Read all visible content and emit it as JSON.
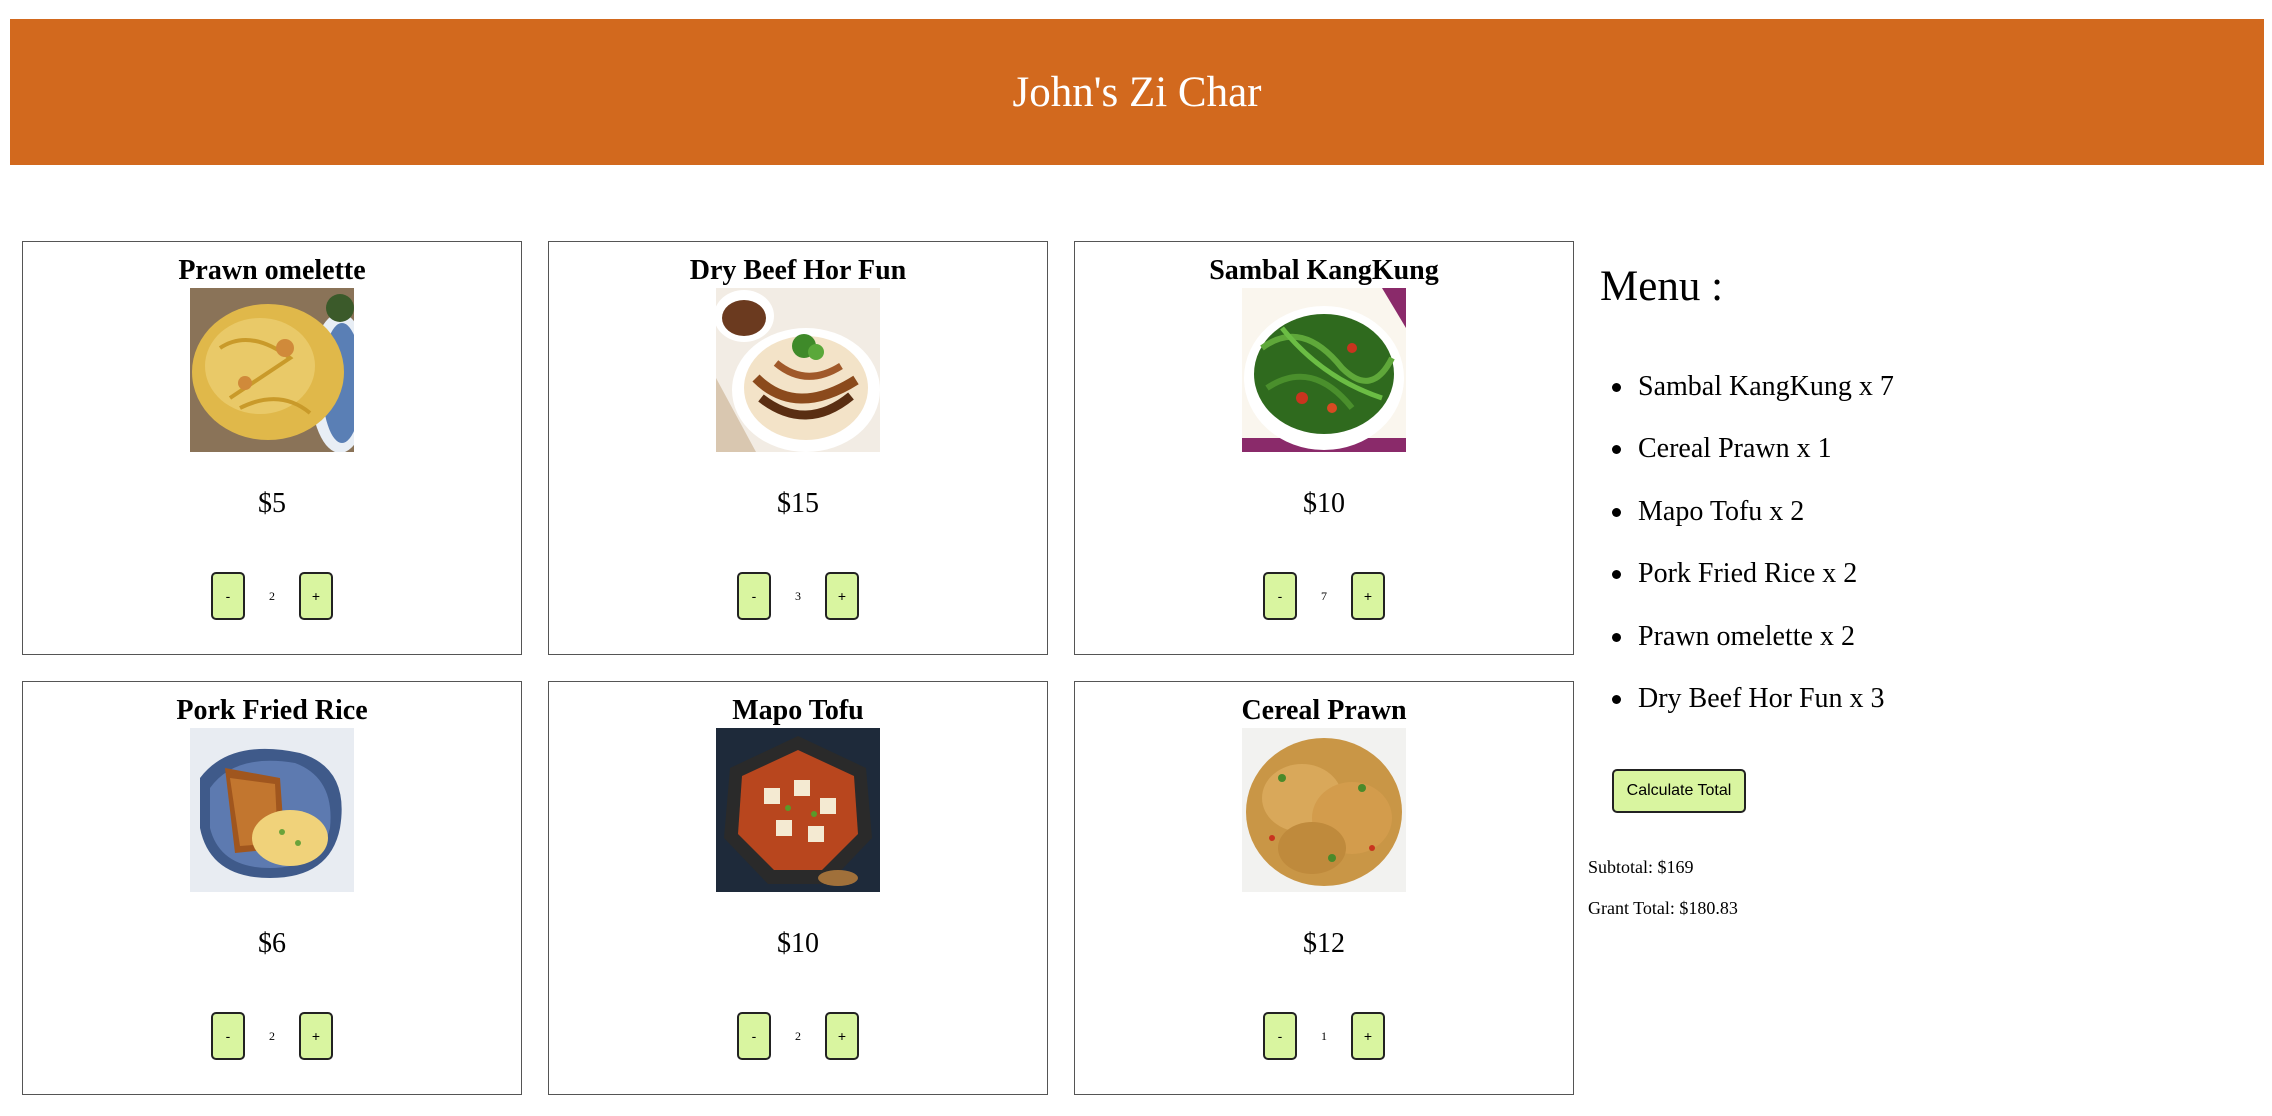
{
  "header": {
    "title": "John's Zi Char"
  },
  "dishes": [
    {
      "name": "Prawn omelette",
      "price": "$5",
      "qty": "2",
      "minus": "-",
      "plus": "+"
    },
    {
      "name": "Dry Beef Hor Fun",
      "price": "$15",
      "qty": "3",
      "minus": "-",
      "plus": "+"
    },
    {
      "name": "Sambal KangKung",
      "price": "$10",
      "qty": "7",
      "minus": "-",
      "plus": "+"
    },
    {
      "name": "Pork Fried Rice",
      "price": "$6",
      "qty": "2",
      "minus": "-",
      "plus": "+"
    },
    {
      "name": "Mapo Tofu",
      "price": "$10",
      "qty": "2",
      "minus": "-",
      "plus": "+"
    },
    {
      "name": "Cereal Prawn",
      "price": "$12",
      "qty": "1",
      "minus": "-",
      "plus": "+"
    }
  ],
  "sidebar": {
    "title": "Menu :",
    "items": [
      "Sambal KangKung x 7",
      "Cereal Prawn x 1",
      "Mapo Tofu x 2",
      "Pork Fried Rice x 2",
      "Prawn omelette x 2",
      "Dry Beef Hor Fun x 3"
    ],
    "calculate_label": "Calculate Total",
    "subtotal": "Subtotal: $169",
    "grand_total": "Grant Total: $180.83"
  },
  "colors": {
    "header_bg": "#d2691e",
    "button_bg": "#d9f5a0"
  }
}
